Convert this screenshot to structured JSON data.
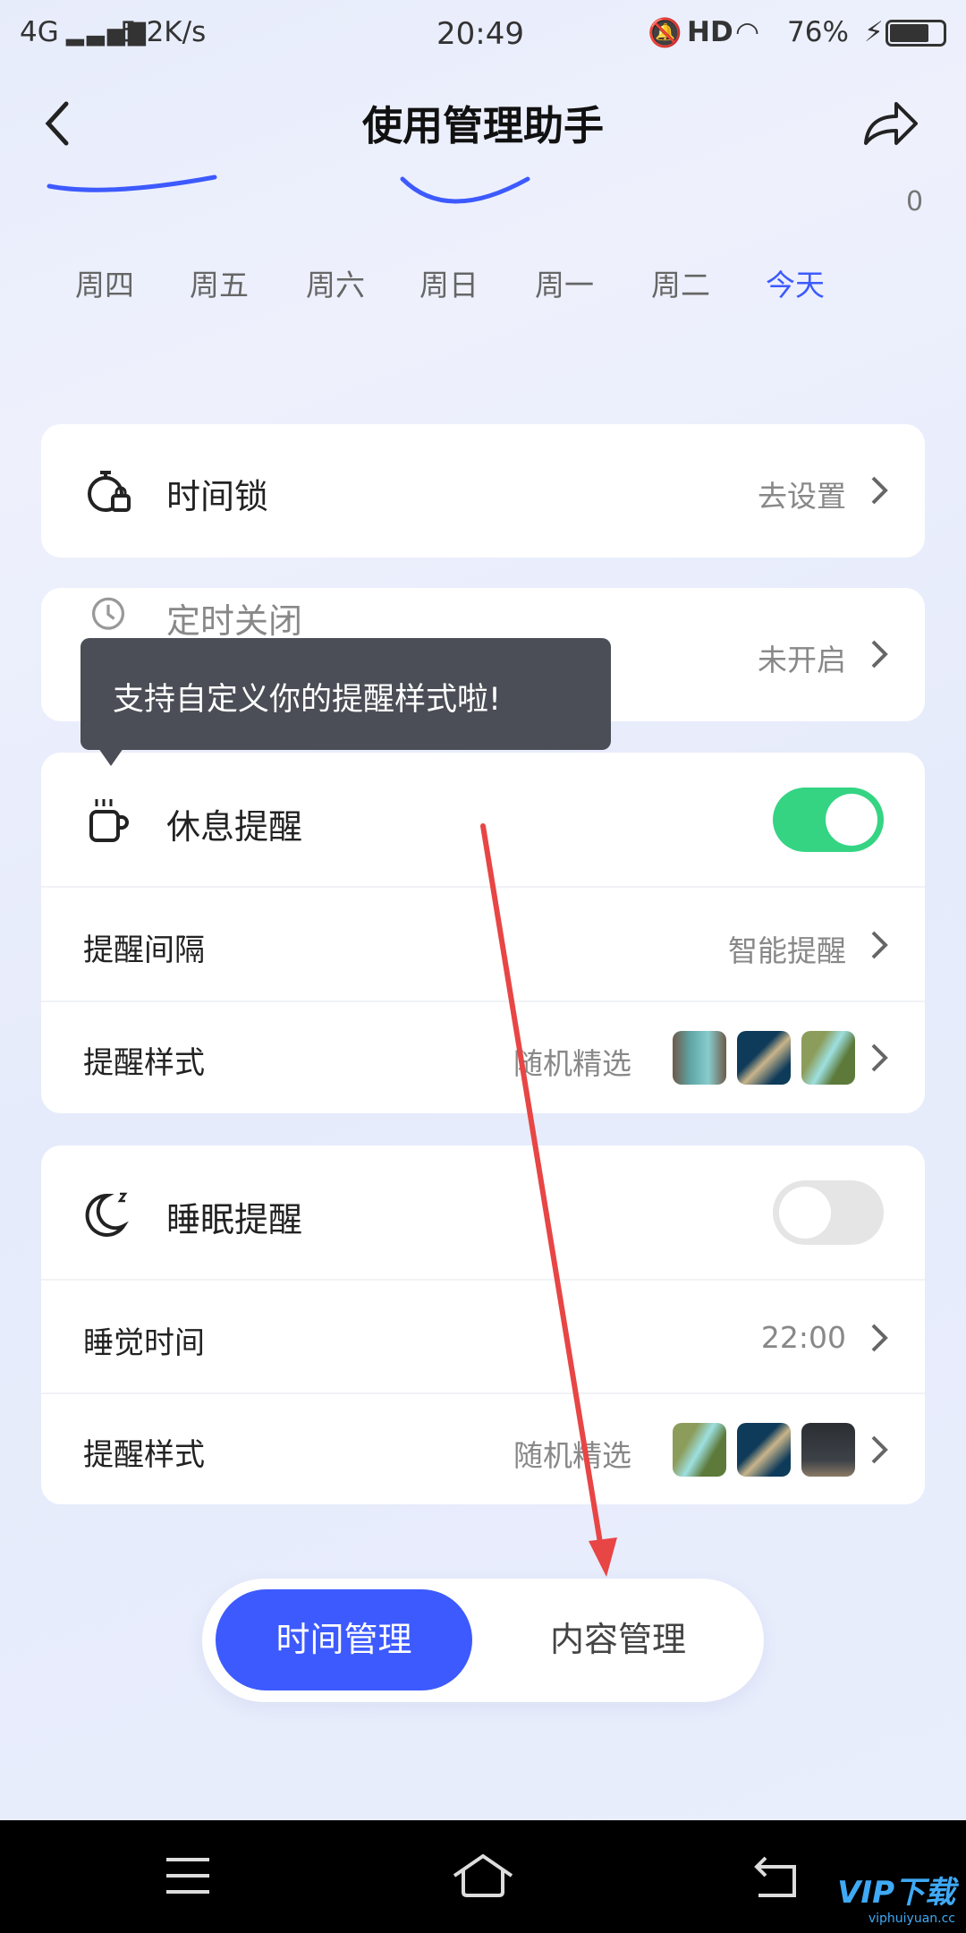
{
  "status": {
    "network": "4G",
    "speed": "5.2K/s",
    "time": "20:49",
    "hd": "HD",
    "battery": "76%"
  },
  "header": {
    "title": "使用管理助手"
  },
  "chart": {
    "axis_value": "0",
    "days": [
      "周四",
      "周五",
      "周六",
      "周日",
      "周一",
      "周二",
      "今天"
    ],
    "active_day": "今天",
    "accent": "#3d5afe"
  },
  "cards": {
    "time_lock": {
      "label": "时间锁",
      "value": "去设置"
    },
    "scheduled_off": {
      "label": "定时关闭",
      "value": "未开启"
    },
    "rest": {
      "label": "休息提醒",
      "enabled": true,
      "interval_label": "提醒间隔",
      "interval_value": "智能提醒",
      "style_label": "提醒样式",
      "style_value": "随机精选"
    },
    "sleep": {
      "label": "睡眠提醒",
      "enabled": false,
      "time_label": "睡觉时间",
      "time_value": "22:00",
      "style_label": "提醒样式",
      "style_value": "随机精选"
    }
  },
  "tooltip": {
    "text": "支持自定义你的提醒样式啦!"
  },
  "tabs": {
    "time": "时间管理",
    "content": "内容管理",
    "active": "时间管理"
  },
  "colors": {
    "toggle_on": "#34d483",
    "toggle_off": "#e5e5e5",
    "tooltip_bg": "#4b4e56",
    "annotation_arrow": "#e84545"
  },
  "watermark": {
    "text": "VIP下载",
    "sub": "viphuiyuan.cc"
  }
}
